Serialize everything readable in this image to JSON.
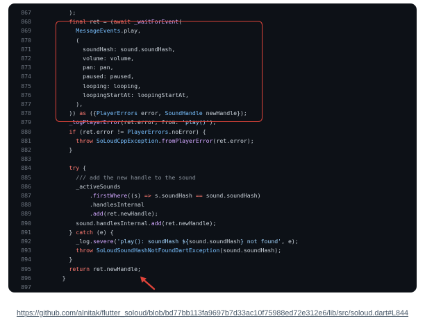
{
  "code": {
    "lines": [
      {
        "n": "867",
        "t": [
          [
            "        );",
            ""
          ]
        ]
      },
      {
        "n": "868",
        "t": [
          [
            "        ",
            ""
          ],
          [
            "final",
            "kw"
          ],
          [
            " ret = (",
            ""
          ],
          [
            "await",
            "kw"
          ],
          [
            " ",
            ""
          ],
          [
            "_waitForEvent",
            "fn"
          ],
          [
            "(",
            ""
          ]
        ]
      },
      {
        "n": "869",
        "t": [
          [
            "          ",
            ""
          ],
          [
            "MessageEvents",
            "ty"
          ],
          [
            ".play,",
            ""
          ]
        ]
      },
      {
        "n": "870",
        "t": [
          [
            "          (",
            ""
          ]
        ]
      },
      {
        "n": "871",
        "t": [
          [
            "            soundHash: sound.soundHash,",
            ""
          ]
        ]
      },
      {
        "n": "872",
        "t": [
          [
            "            volume: volume,",
            ""
          ]
        ]
      },
      {
        "n": "873",
        "t": [
          [
            "            pan: pan,",
            ""
          ]
        ]
      },
      {
        "n": "874",
        "t": [
          [
            "            paused: paused,",
            ""
          ]
        ]
      },
      {
        "n": "875",
        "t": [
          [
            "            looping: looping,",
            ""
          ]
        ]
      },
      {
        "n": "876",
        "t": [
          [
            "            loopingStartAt: loopingStartAt,",
            ""
          ]
        ]
      },
      {
        "n": "877",
        "t": [
          [
            "          ),",
            ""
          ]
        ]
      },
      {
        "n": "878",
        "t": [
          [
            "        )) ",
            ""
          ],
          [
            "as",
            "kw"
          ],
          [
            " ({",
            ""
          ],
          [
            "PlayerErrors",
            "ty"
          ],
          [
            " error, ",
            ""
          ],
          [
            "SoundHandle",
            "ty"
          ],
          [
            " newHandle});",
            ""
          ]
        ]
      },
      {
        "n": "879",
        "t": [
          [
            "        ",
            ""
          ],
          [
            "_logPlayerError",
            "fn"
          ],
          [
            "(ret.error, from: ",
            ""
          ],
          [
            "'play()'",
            "st"
          ],
          [
            ");",
            ""
          ]
        ]
      },
      {
        "n": "880",
        "t": [
          [
            "        ",
            ""
          ],
          [
            "if",
            "kw"
          ],
          [
            " (ret.error != ",
            ""
          ],
          [
            "PlayerErrors",
            "ty"
          ],
          [
            ".noError) {",
            ""
          ]
        ]
      },
      {
        "n": "881",
        "t": [
          [
            "          ",
            ""
          ],
          [
            "throw",
            "kw"
          ],
          [
            " ",
            ""
          ],
          [
            "SoLoudCppException",
            "ty"
          ],
          [
            ".",
            ""
          ],
          [
            "fromPlayerError",
            "fn"
          ],
          [
            "(ret.error);",
            ""
          ]
        ]
      },
      {
        "n": "882",
        "t": [
          [
            "        }",
            ""
          ]
        ]
      },
      {
        "n": "883",
        "t": [
          [
            "",
            ""
          ]
        ]
      },
      {
        "n": "884",
        "t": [
          [
            "        ",
            ""
          ],
          [
            "try",
            "kw"
          ],
          [
            " {",
            ""
          ]
        ]
      },
      {
        "n": "885",
        "t": [
          [
            "          /// add the new handle to the sound",
            "cm"
          ]
        ]
      },
      {
        "n": "886",
        "t": [
          [
            "          _activeSounds",
            ""
          ]
        ]
      },
      {
        "n": "887",
        "t": [
          [
            "              .",
            ""
          ],
          [
            "firstWhere",
            "fn"
          ],
          [
            "((s) ",
            ""
          ],
          [
            "=>",
            "kw"
          ],
          [
            " s.soundHash ",
            ""
          ],
          [
            "==",
            "kw"
          ],
          [
            " sound.soundHash)",
            ""
          ]
        ]
      },
      {
        "n": "888",
        "t": [
          [
            "              .handlesInternal",
            ""
          ]
        ]
      },
      {
        "n": "889",
        "t": [
          [
            "              .",
            ""
          ],
          [
            "add",
            "fn"
          ],
          [
            "(ret.newHandle);",
            ""
          ]
        ]
      },
      {
        "n": "890",
        "t": [
          [
            "          sound.handlesInternal.",
            ""
          ],
          [
            "add",
            "fn"
          ],
          [
            "(ret.newHandle);",
            ""
          ]
        ]
      },
      {
        "n": "891",
        "t": [
          [
            "        } ",
            ""
          ],
          [
            "catch",
            "kw"
          ],
          [
            " (e) {",
            ""
          ]
        ]
      },
      {
        "n": "892",
        "t": [
          [
            "          _log.",
            ""
          ],
          [
            "severe",
            "fn"
          ],
          [
            "(",
            ""
          ],
          [
            "'play(): soundHash ${",
            "st"
          ],
          [
            "sound.soundHash",
            ""
          ],
          [
            "} not found'",
            "st"
          ],
          [
            ", e);",
            ""
          ]
        ]
      },
      {
        "n": "893",
        "t": [
          [
            "          ",
            ""
          ],
          [
            "throw",
            "kw"
          ],
          [
            " ",
            ""
          ],
          [
            "SoLoudSoundHashNotFoundDartException",
            "ty"
          ],
          [
            "(sound.soundHash);",
            ""
          ]
        ]
      },
      {
        "n": "894",
        "t": [
          [
            "        }",
            ""
          ]
        ]
      },
      {
        "n": "895",
        "t": [
          [
            "        ",
            ""
          ],
          [
            "return",
            "kw"
          ],
          [
            " ret.newHandle;",
            ""
          ]
        ]
      },
      {
        "n": "896",
        "t": [
          [
            "      }",
            ""
          ]
        ]
      },
      {
        "n": "897",
        "t": [
          [
            "",
            ""
          ]
        ]
      }
    ]
  },
  "annotations": {
    "highlight_color": "#e0443a",
    "arrow_color": "#e0443a"
  },
  "caption": {
    "link_text": "https://github.com/alnitak/flutter_soloud/blob/bd77bb113fa9697b7d33ac10f75988ed72e312e6/lib/src/soloud.dart#L844"
  }
}
